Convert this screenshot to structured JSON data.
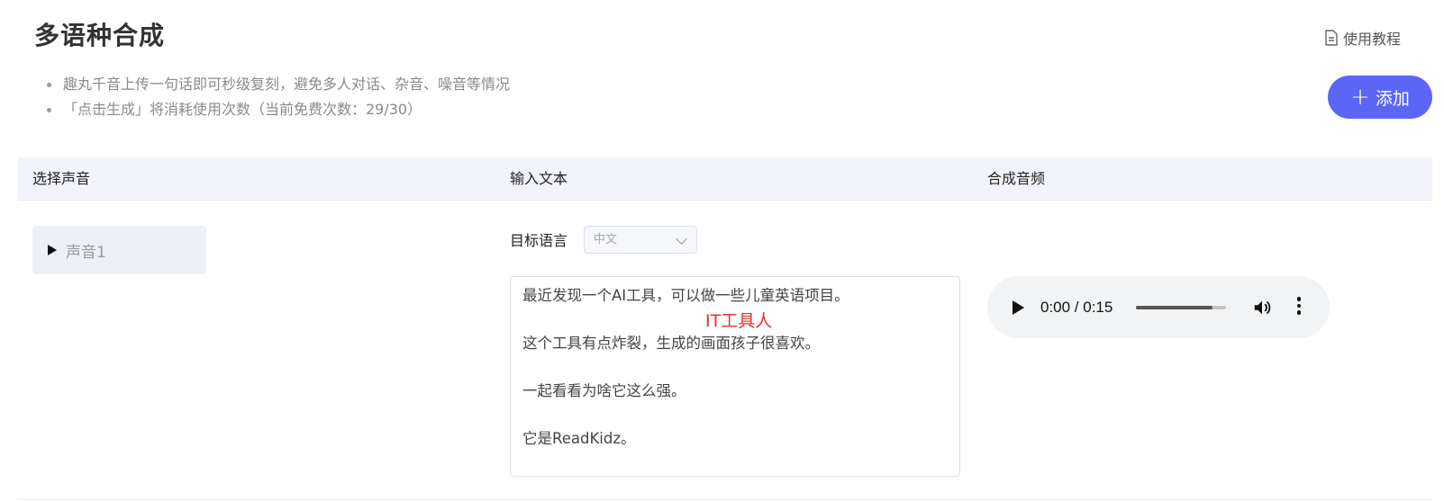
{
  "page": {
    "title": "多语种合成"
  },
  "header": {
    "tutorial_label": "使用教程",
    "tutorial_icon": "document-icon"
  },
  "notes": [
    "趣丸千音上传一句话即可秒级复刻，避免多人对话、杂音、噪音等情况",
    "「点击生成」将消耗使用次数（当前免费次数：29/30）"
  ],
  "toolbar": {
    "add_label": "添加",
    "add_icon": "plus-icon",
    "accent_color": "#5b66f6"
  },
  "table": {
    "columns": [
      "选择声音",
      "输入文本",
      "合成音频"
    ],
    "rows": [
      {
        "voice": {
          "label": "声音1",
          "icon": "play-triangle-icon"
        },
        "language": {
          "label": "目标语言",
          "selected": "中文"
        },
        "text_lines": [
          "最近发现一个AI工具，可以做一些儿童英语项目。",
          "",
          "这个工具有点炸裂，生成的画面孩子很喜欢。",
          "",
          "一起看看为啥它这么强。",
          "",
          "它是ReadKidz。"
        ],
        "audio": {
          "time": "0:00 / 0:15",
          "progress_fraction": 0.85
        }
      }
    ]
  },
  "watermark": {
    "text": "IT工具人",
    "color": "#e03131"
  }
}
